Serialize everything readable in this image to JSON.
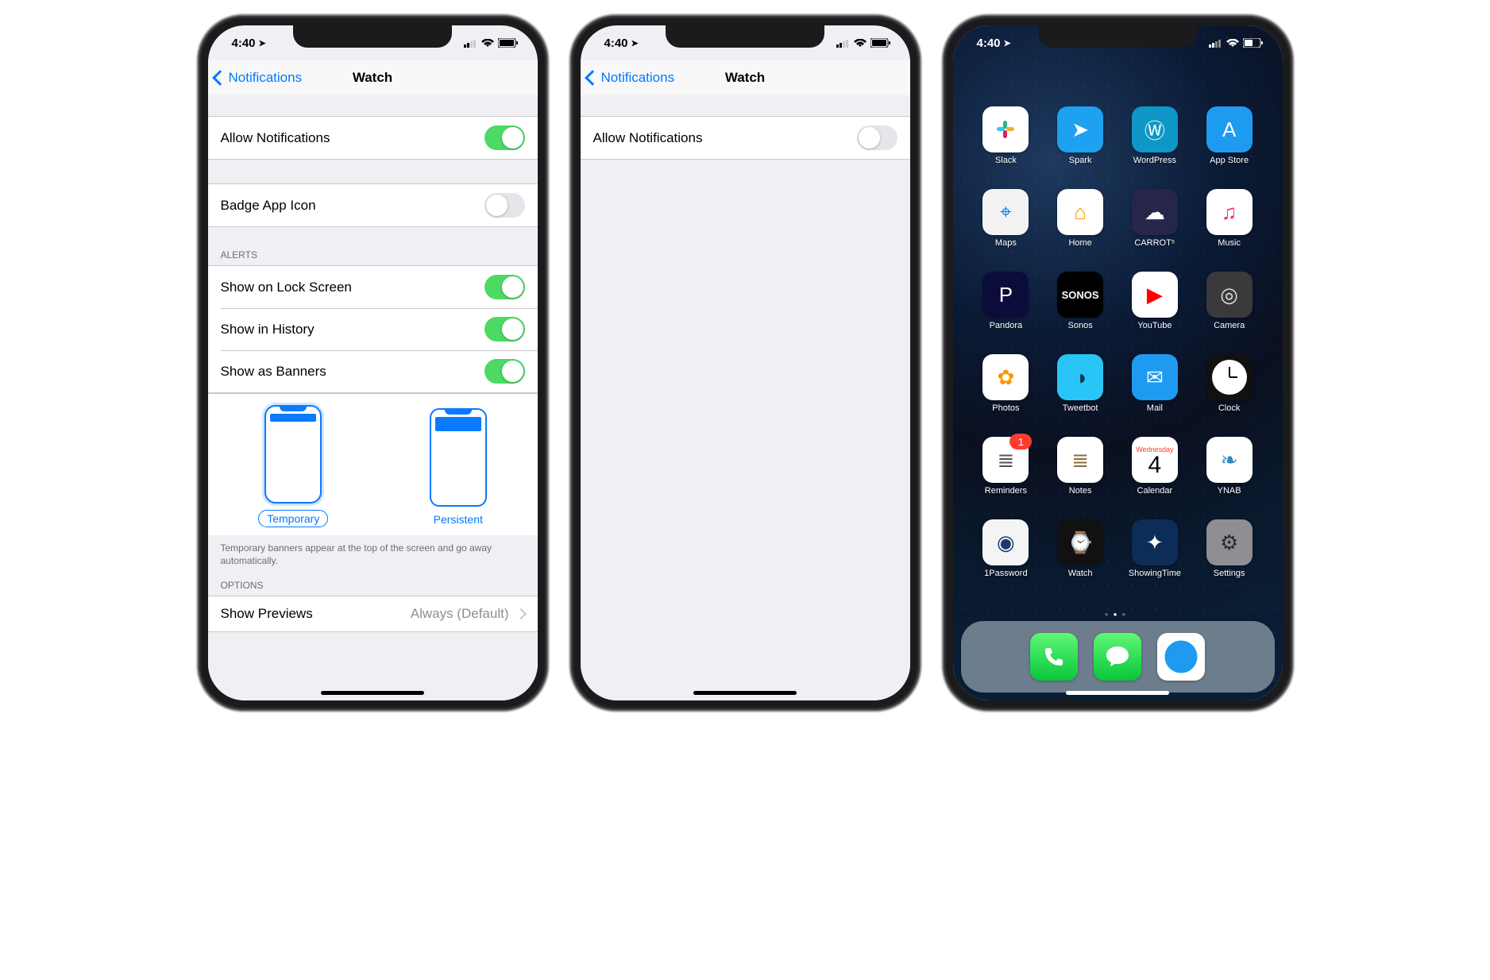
{
  "status": {
    "time": "4:40"
  },
  "settings": {
    "back_label": "Notifications",
    "title": "Watch",
    "allow_notifications": "Allow Notifications",
    "badge_app_icon": "Badge App Icon",
    "alerts_header": "ALERTS",
    "show_lock": "Show on Lock Screen",
    "show_history": "Show in History",
    "show_banners": "Show as Banners",
    "style_temporary": "Temporary",
    "style_persistent": "Persistent",
    "style_footer": "Temporary banners appear at the top of the screen and go away automatically.",
    "options_header": "OPTIONS",
    "show_previews": "Show Previews",
    "show_previews_value": "Always (Default)"
  },
  "toggles_left": {
    "allow": true,
    "badge": false,
    "lock": true,
    "history": true,
    "banners": true
  },
  "toggles_mid": {
    "allow": false
  },
  "home": {
    "calendar_dow": "Wednesday",
    "calendar_day": "4",
    "reminders_badge": "1",
    "apps": [
      {
        "label": "Slack",
        "bg": "#ffffff",
        "fg": "#000",
        "glyph": ""
      },
      {
        "label": "Spark",
        "bg": "#1ea1f1",
        "fg": "#fff",
        "glyph": "➤"
      },
      {
        "label": "WordPress",
        "bg": "#0f97c8",
        "fg": "#fff",
        "glyph": "Ⓦ"
      },
      {
        "label": "App Store",
        "bg": "#1e9bf0",
        "fg": "#fff",
        "glyph": "A"
      },
      {
        "label": "Maps",
        "bg": "#f2f2f2",
        "fg": "#007aff",
        "glyph": "⌖"
      },
      {
        "label": "Home",
        "bg": "#ffffff",
        "fg": "#ff9500",
        "glyph": "⌂"
      },
      {
        "label": "CARROT⁵",
        "bg": "#26254a",
        "fg": "#fff",
        "glyph": "☁"
      },
      {
        "label": "Music",
        "bg": "#ffffff",
        "fg": "#ff2d55",
        "glyph": "♫"
      },
      {
        "label": "Pandora",
        "bg": "#0c0c3b",
        "fg": "#fff",
        "glyph": "P"
      },
      {
        "label": "Sonos",
        "bg": "#000000",
        "fg": "#fff",
        "glyph": "S"
      },
      {
        "label": "YouTube",
        "bg": "#ffffff",
        "fg": "#ff0000",
        "glyph": "▶"
      },
      {
        "label": "Camera",
        "bg": "#3a3a3c",
        "fg": "#ddd",
        "glyph": "◎"
      },
      {
        "label": "Photos",
        "bg": "#ffffff",
        "fg": "#ff9500",
        "glyph": "✿"
      },
      {
        "label": "Tweetbot",
        "bg": "#29c5f6",
        "fg": "#10384f",
        "glyph": "◑"
      },
      {
        "label": "Mail",
        "bg": "#1e9bf0",
        "fg": "#fff",
        "glyph": "✉"
      },
      {
        "label": "Clock",
        "bg": "#111",
        "fg": "#fff",
        "glyph": "◷"
      },
      {
        "label": "Reminders",
        "bg": "#ffffff",
        "fg": "#555",
        "glyph": "≣",
        "badge": true
      },
      {
        "label": "Notes",
        "bg": "#ffffff",
        "fg": "#8a6d3b",
        "glyph": "≣"
      },
      {
        "label": "Calendar",
        "calendar": true
      },
      {
        "label": "YNAB",
        "bg": "#ffffff",
        "fg": "#2f88c3",
        "glyph": "❧"
      },
      {
        "label": "1Password",
        "bg": "#f4f4f4",
        "fg": "#1b3b6f",
        "glyph": "◉"
      },
      {
        "label": "Watch",
        "bg": "#111",
        "fg": "#fff",
        "glyph": "⌚"
      },
      {
        "label": "ShowingTime",
        "bg": "#0b2d57",
        "fg": "#fff",
        "glyph": "✦"
      },
      {
        "label": "Settings",
        "bg": "#8e8e93",
        "fg": "#2c2c2e",
        "glyph": "⚙"
      }
    ],
    "dock": [
      {
        "name": "phone",
        "bg": "#34c759",
        "fg": "#fff",
        "glyph": "✆"
      },
      {
        "name": "messages",
        "bg": "#34c759",
        "fg": "#fff",
        "glyph": "✉"
      },
      {
        "name": "safari",
        "bg": "#ffffff",
        "fg": "#007aff",
        "glyph": "✦"
      }
    ]
  }
}
